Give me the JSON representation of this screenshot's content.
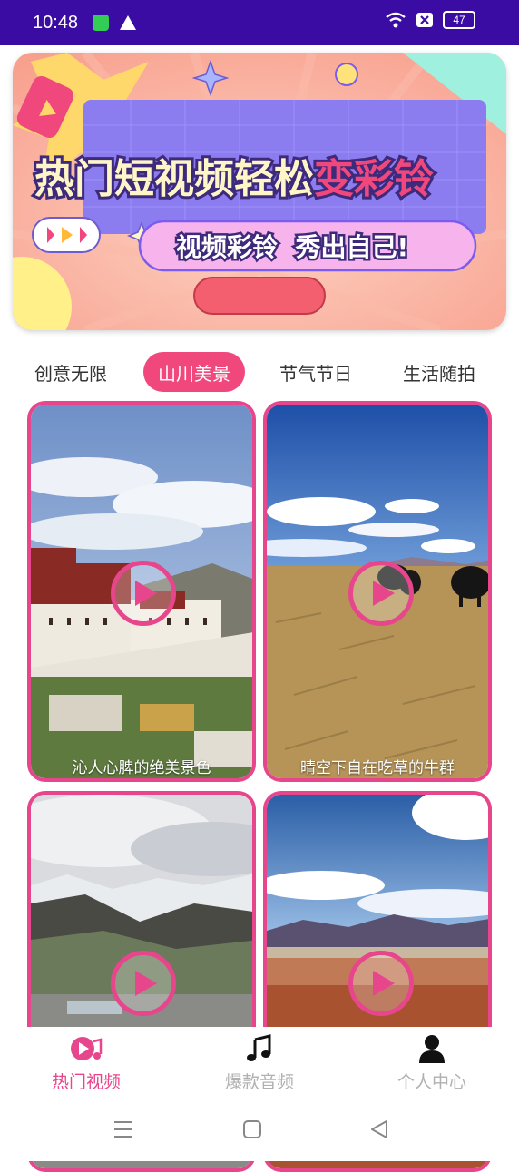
{
  "status_bar": {
    "time": "10:48",
    "battery": "47",
    "icons": [
      "app-notification-icon",
      "warning-icon",
      "wifi-icon",
      "no-sim-icon",
      "battery-icon"
    ]
  },
  "banner": {
    "headline_part1": "热门短视频轻松",
    "headline_part2": "变彩铃",
    "subtitle": "视频彩铃  秀出自己!",
    "colors": {
      "background": "#f9a38f",
      "accent_pink": "#f0477d",
      "purple": "#8b7cf0"
    }
  },
  "tabs": [
    {
      "label": "创意无限",
      "active": false
    },
    {
      "label": "山川美景",
      "active": true
    },
    {
      "label": "节气节日",
      "active": false
    },
    {
      "label": "生活随拍",
      "active": false
    }
  ],
  "videos": [
    {
      "caption": "沁人心脾的绝美景色"
    },
    {
      "caption": "晴空下自在吃草的牛群"
    },
    {
      "caption": ""
    },
    {
      "caption": ""
    }
  ],
  "bottom_nav": [
    {
      "label": "热门视频",
      "icon": "play-music-icon",
      "active": true
    },
    {
      "label": "爆款音频",
      "icon": "music-note-icon",
      "active": false
    },
    {
      "label": "个人中心",
      "icon": "person-icon",
      "active": false
    }
  ],
  "system_nav": [
    "menu-icon",
    "home-icon",
    "back-icon"
  ],
  "accent_color": "#e8468c"
}
